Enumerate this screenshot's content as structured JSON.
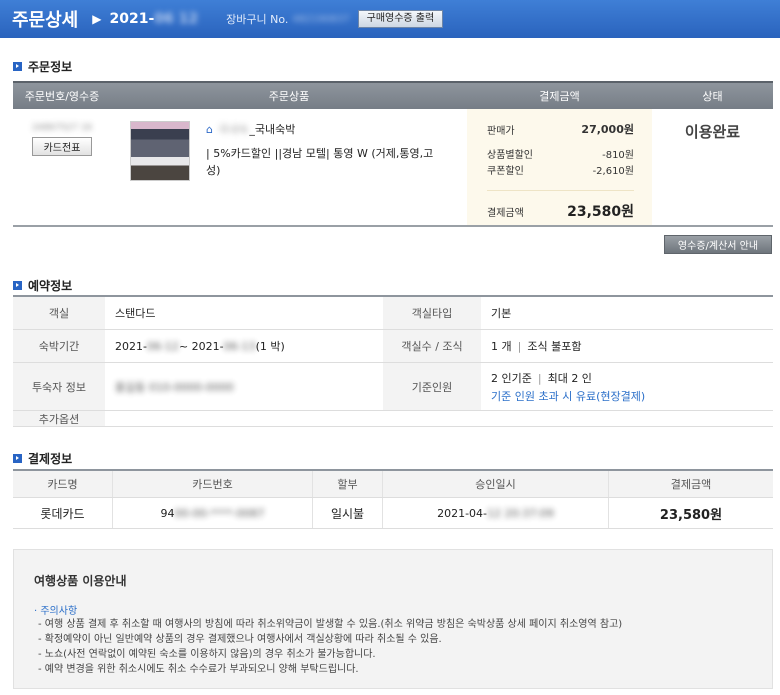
{
  "header": {
    "title": "주문상세",
    "date_prefix": "2021-",
    "date_hidden": "06 12",
    "cart_label": "장바구니 No.",
    "cart_no": "482190837",
    "print_button": "구매영수증 출력"
  },
  "order_section": {
    "title": "주문정보",
    "columns": [
      "주문번호/영수증",
      "주문상품",
      "결제금액",
      "상태"
    ],
    "order_no": "24867527 16",
    "card_button": "카드전표",
    "product_category_hidden": "국내숙박",
    "product_category": "_국내숙박",
    "product_name": "| 5%카드할인 ||경남 모텔| 통영 W (거제,통영,고성)",
    "price_rows": [
      {
        "label": "판매가",
        "value": "27,000원"
      },
      {
        "label": "상품별할인",
        "value": "-810원"
      },
      {
        "label": "쿠폰할인",
        "value": "-2,610원"
      }
    ],
    "total_label": "결제금액",
    "total_value": "23,580원",
    "status": "이용완료",
    "receipt_button": "영수증/계산서 안내"
  },
  "reservation_section": {
    "title": "예약정보",
    "room_label": "객실",
    "room_value": "스탠다드",
    "room_type_label": "객실타입",
    "room_type_value": "기본",
    "stay_label": "숙박기간",
    "stay_start": "2021-",
    "stay_start_hidden": "06-12",
    "stay_mid": " ~ 2021-",
    "stay_end_hidden": "06-13",
    "stay_nights": "(1 박)",
    "rooms_label": "객실수 / 조식",
    "rooms_count": "1 개",
    "breakfast": "조식 불포함",
    "guest_label": "투숙자 정보",
    "guest_hidden": "홍길동 010-0000-0000",
    "base_label": "기준인원",
    "base_value": "2 인기준",
    "max_value": "최대 2 인",
    "extra_note": "기준 인원 초과 시 유료(현장결제)",
    "options_label": "추가옵션"
  },
  "payment_section": {
    "title": "결제정보",
    "columns": [
      "카드명",
      "카드번호",
      "할부",
      "승인일시",
      "결제금액"
    ],
    "card_name": "롯데카드",
    "card_no_prefix": "94",
    "card_no_hidden": "00-00-****-0087",
    "installment": "일시불",
    "approval_prefix": "2021-04-",
    "approval_hidden": "12 20:37:09",
    "amount": "23,580원"
  },
  "guide": {
    "title": "여행상품 이용안내",
    "subtitle": "· 주의사항",
    "items": [
      "- 여행 상품 결제 후 취소할 때 여행사의 방침에 따라 취소위약금이 발생할 수 있음.(취소 위약금 방침은 숙박상품 상세 페이지 취소영역 참고)",
      "- 확정예약이 아닌 일반예약 상품의 경우 결제했으나 여행사에서 객실상황에 따라 취소될 수 있음.",
      "- 노쇼(사전 연락없이 예약된 숙소를 이용하지 않음)의 경우 취소가 불가능합니다.",
      "- 예약 변경을 위한 취소시에도 취소 수수료가 부과되오니 양해 부탁드립니다."
    ]
  }
}
